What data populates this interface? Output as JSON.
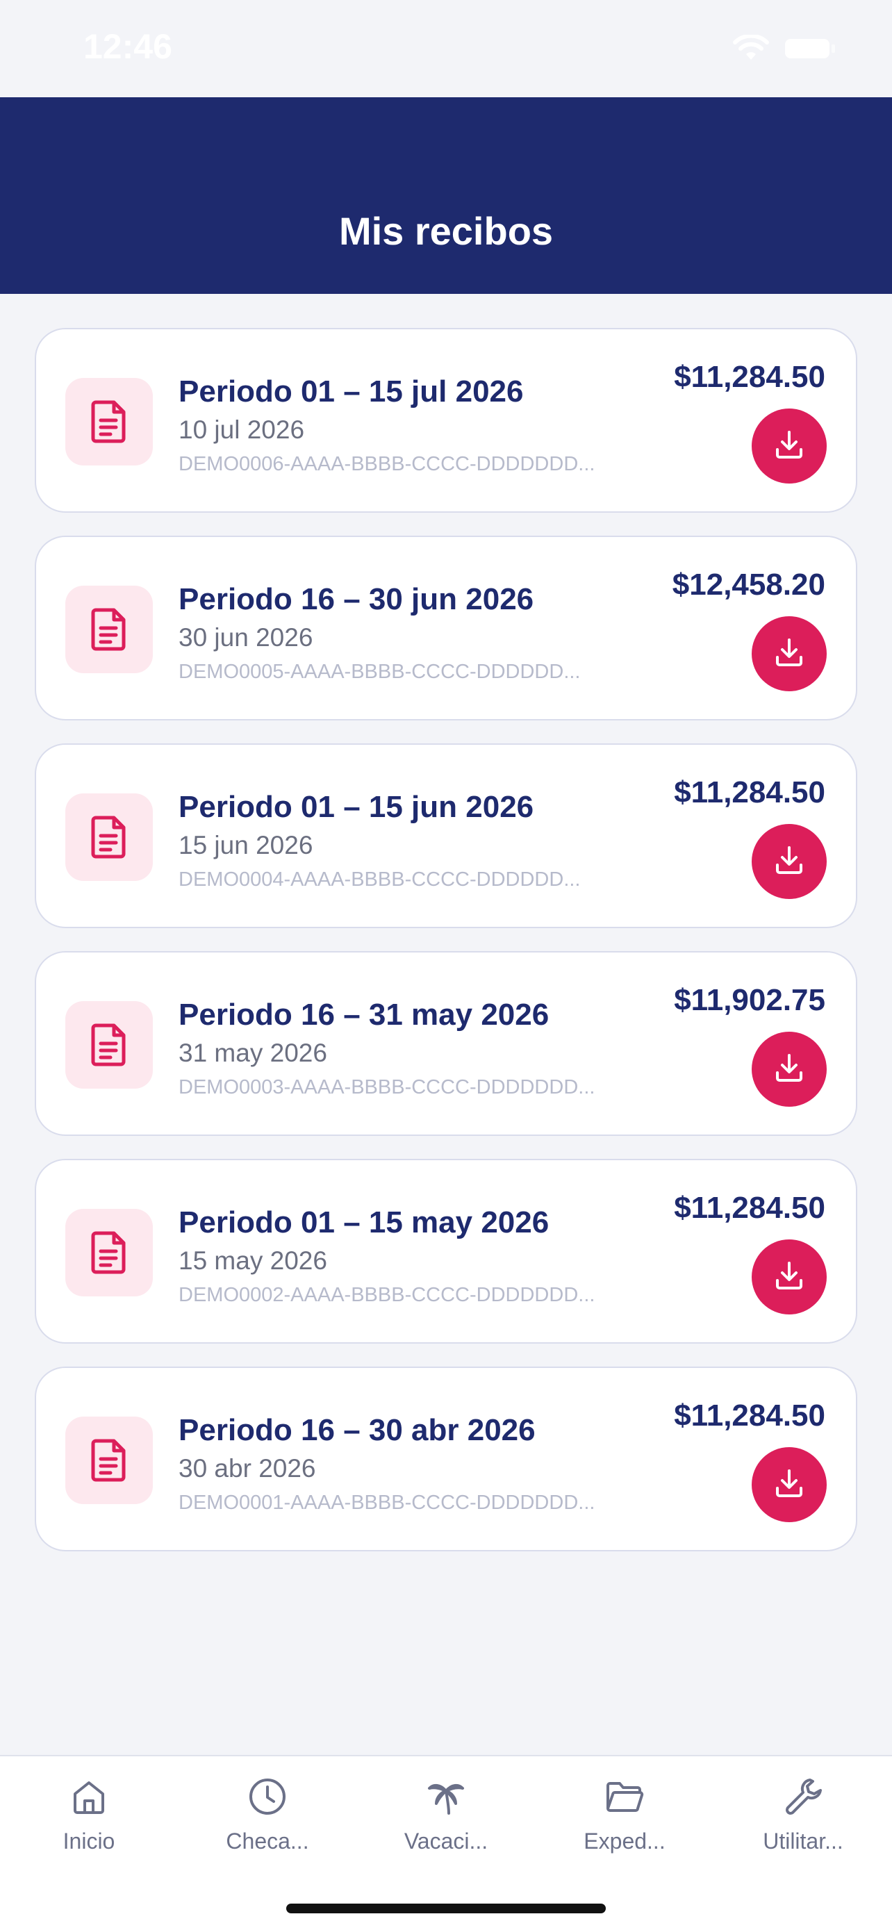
{
  "status_bar": {
    "time": "12:46"
  },
  "header": {
    "title": "Mis recibos"
  },
  "receipts": [
    {
      "period": "Periodo 01 – 15 jul 2026",
      "date": "10 jul 2026",
      "id": "DEMO0006-AAAA-BBBB-CCCC-DDDDDDD...",
      "amount": "$11,284.50"
    },
    {
      "period": "Periodo 16 – 30 jun 2026",
      "date": "30 jun 2026",
      "id": "DEMO0005-AAAA-BBBB-CCCC-DDDDDD...",
      "amount": "$12,458.20"
    },
    {
      "period": "Periodo 01 – 15 jun 2026",
      "date": "15 jun 2026",
      "id": "DEMO0004-AAAA-BBBB-CCCC-DDDDDD...",
      "amount": "$11,284.50"
    },
    {
      "period": "Periodo 16 – 31 may 2026",
      "date": "31 may 2026",
      "id": "DEMO0003-AAAA-BBBB-CCCC-DDDDDDD...",
      "amount": "$11,902.75"
    },
    {
      "period": "Periodo 01 – 15 may 2026",
      "date": "15 may 2026",
      "id": "DEMO0002-AAAA-BBBB-CCCC-DDDDDDD...",
      "amount": "$11,284.50"
    },
    {
      "period": "Periodo 16 – 30 abr 2026",
      "date": "30 abr 2026",
      "id": "DEMO0001-AAAA-BBBB-CCCC-DDDDDDD...",
      "amount": "$11,284.50"
    }
  ],
  "tabs": [
    {
      "label": "Inicio",
      "icon": "home-icon"
    },
    {
      "label": "Checa...",
      "icon": "clock-icon"
    },
    {
      "label": "Vacaci...",
      "icon": "palm-tree-icon"
    },
    {
      "label": "Exped...",
      "icon": "folder-icon"
    },
    {
      "label": "Utilitar...",
      "icon": "wrench-icon"
    }
  ],
  "colors": {
    "header_bg": "#1e2a6e",
    "accent": "#dc1e5a",
    "tile_bg": "#fde8ee",
    "page_bg": "#f3f4f8"
  }
}
